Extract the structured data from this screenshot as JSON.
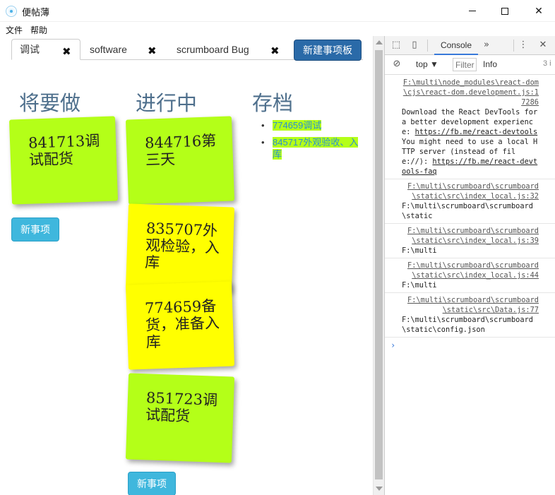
{
  "window": {
    "title": "便帖薄",
    "min_label": "–",
    "max_label": "□",
    "close_label": "✕"
  },
  "menu": [
    "文件",
    "帮助"
  ],
  "tabs": [
    {
      "label": "调试",
      "active": true
    },
    {
      "label": "software",
      "active": false
    },
    {
      "label": "scrumboard Bug",
      "active": false
    }
  ],
  "tab_close_glyph": "✖",
  "new_board_label": "新建事项板",
  "columns": {
    "todo": {
      "title": "将要做",
      "notes": [
        {
          "text": "841713调试配货",
          "color": "green"
        }
      ],
      "new_label": "新事项"
    },
    "doing": {
      "title": "进行中",
      "notes": [
        {
          "text": "844716第三天",
          "color": "green"
        },
        {
          "text": "835707外观检验，入库",
          "color": "yellow"
        },
        {
          "text": "774659备货，准备入库",
          "color": "yellow"
        },
        {
          "text": "851723调试配货",
          "color": "green"
        }
      ],
      "new_label": "新事项"
    },
    "archive": {
      "title": "存档",
      "items": [
        "774659调试",
        "845717外观验收、入库"
      ]
    }
  },
  "colors": {
    "note_green": "#b4ff18",
    "note_yellow": "#ffff00",
    "button_blue": "#3fb7dd",
    "board_button": "#2a6aa8"
  },
  "devtools": {
    "tab": "Console",
    "more": "»",
    "context": "top",
    "filter_placeholder": "Filter",
    "level": "Info",
    "count": "3 i",
    "messages": [
      {
        "source": "F:\\multi\\node_modules\\react-dom\\cjs\\react-dom.development.js:17286",
        "text": "Download the React DevTools for a better development experience: ",
        "link1": "https://fb.me/react-devtools",
        "text2": "\nYou might need to use a local HTTP server (instead of file://): ",
        "link2": "https://fb.me/react-devtools-faq"
      },
      {
        "source": "F:\\multi\\scrumboard\\scrumboard\\static\\src\\index_local.js:32",
        "text": "F:\\multi\\scrumboard\\scrumboard\\static"
      },
      {
        "source": "F:\\multi\\scrumboard\\scrumboard\\static\\src\\index_local.js:39",
        "text": "F:\\multi"
      },
      {
        "source": "F:\\multi\\scrumboard\\scrumboard\\static\\src\\index_local.js:44",
        "text": "F:\\multi"
      },
      {
        "source": "F:\\multi\\scrumboard\\scrumboard\\static\\src\\Data.js:77",
        "text": "F:\\multi\\scrumboard\\scrumboard\\static\\config.json"
      }
    ],
    "prompt": "›"
  }
}
